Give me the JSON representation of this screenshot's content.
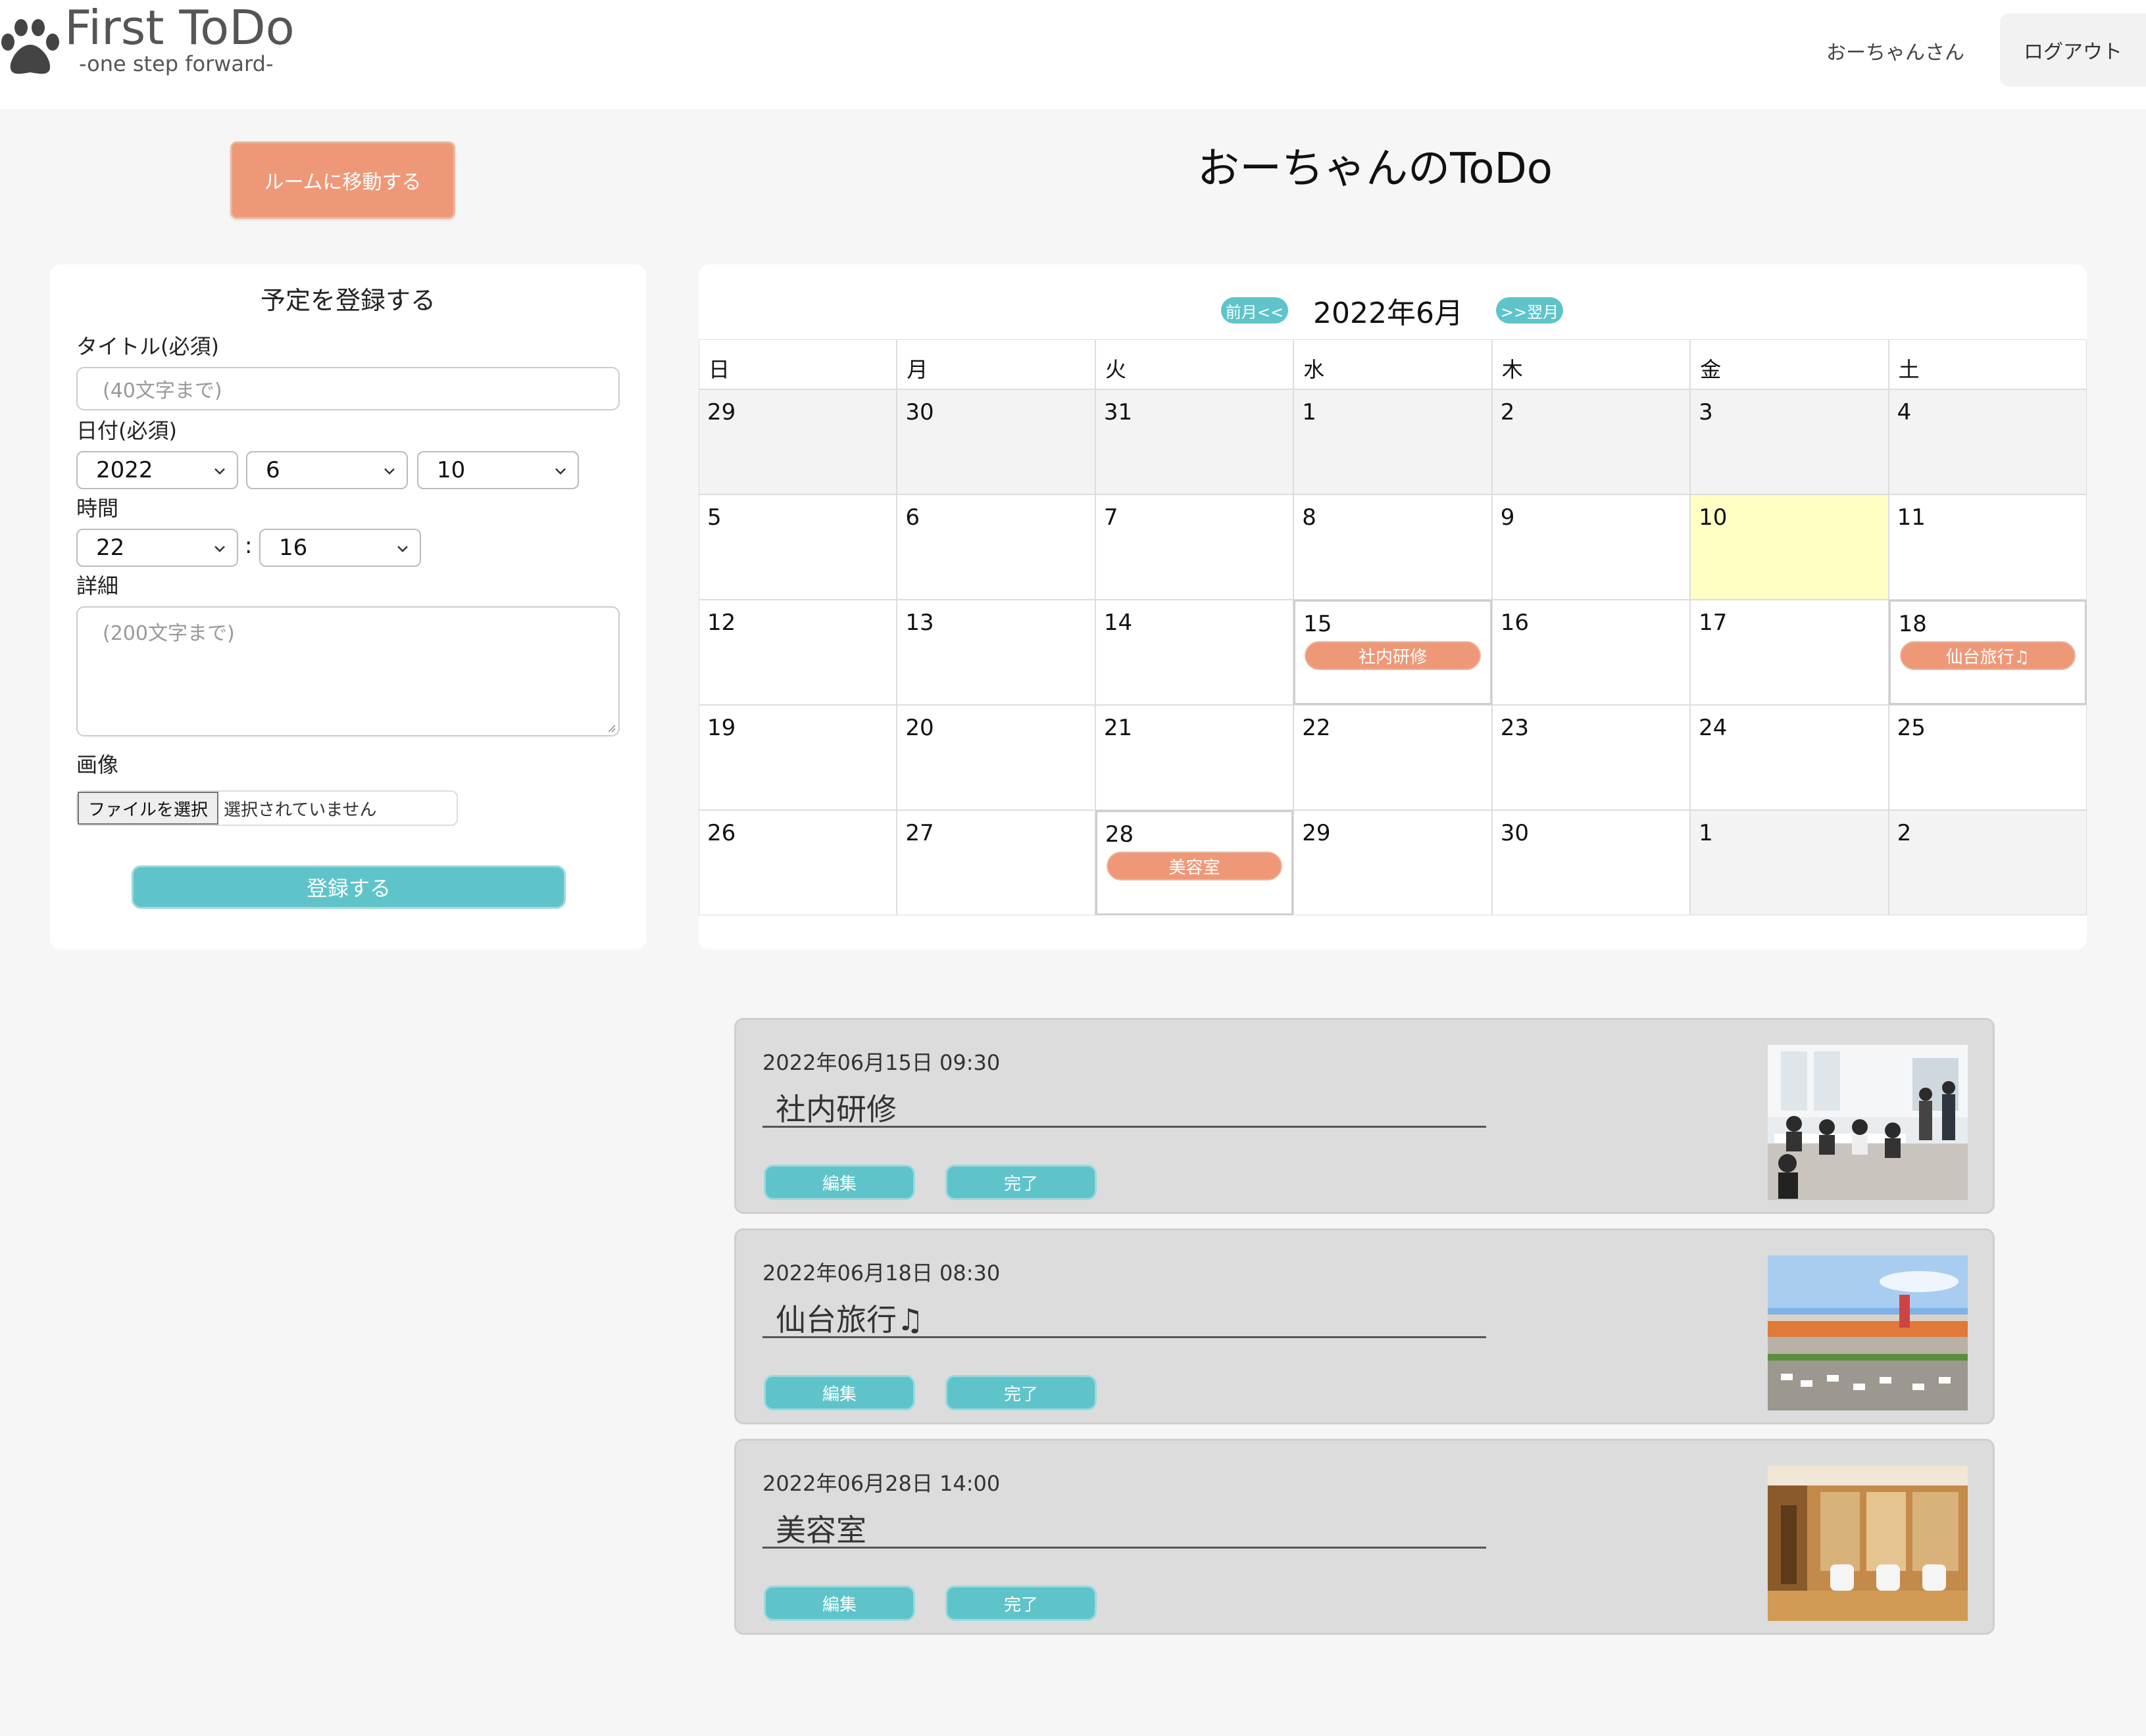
{
  "header": {
    "brand_title": "First ToDo",
    "brand_subtitle": "-one step forward-",
    "user_name": "おーちゃんさん",
    "logout_label": "ログアウト"
  },
  "room_button_label": "ルームに移動する",
  "page_title": "おーちゃんのToDo",
  "form": {
    "heading": "予定を登録する",
    "title_label": "タイトル(必須)",
    "title_placeholder": "(40文字まで)",
    "date_label": "日付(必須)",
    "year": "2022",
    "month": "6",
    "day": "10",
    "time_label": "時間",
    "hour": "22",
    "time_separator": ":",
    "minute": "16",
    "detail_label": "詳細",
    "detail_placeholder": "(200文字まで)",
    "image_label": "画像",
    "file_button": "ファイルを選択",
    "file_status": "選択されていません",
    "submit_label": "登録する"
  },
  "calendar": {
    "prev_label": "前月<<",
    "month_label": "2022年6月",
    "next_label": ">>翌月",
    "weekdays": [
      "日",
      "月",
      "火",
      "水",
      "木",
      "金",
      "土"
    ],
    "weeks": [
      [
        {
          "d": "29",
          "other": true
        },
        {
          "d": "30",
          "other": true
        },
        {
          "d": "31",
          "other": true
        },
        {
          "d": "1",
          "other": true
        },
        {
          "d": "2",
          "other": true
        },
        {
          "d": "3",
          "other": true
        },
        {
          "d": "4",
          "other": true
        }
      ],
      [
        {
          "d": "5"
        },
        {
          "d": "6"
        },
        {
          "d": "7"
        },
        {
          "d": "8"
        },
        {
          "d": "9"
        },
        {
          "d": "10",
          "today": true
        },
        {
          "d": "11"
        }
      ],
      [
        {
          "d": "12"
        },
        {
          "d": "13"
        },
        {
          "d": "14"
        },
        {
          "d": "15",
          "event": "社内研修"
        },
        {
          "d": "16"
        },
        {
          "d": "17"
        },
        {
          "d": "18",
          "event": "仙台旅行♫"
        }
      ],
      [
        {
          "d": "19"
        },
        {
          "d": "20"
        },
        {
          "d": "21"
        },
        {
          "d": "22"
        },
        {
          "d": "23"
        },
        {
          "d": "24"
        },
        {
          "d": "25"
        }
      ],
      [
        {
          "d": "26"
        },
        {
          "d": "27"
        },
        {
          "d": "28",
          "event": "美容室"
        },
        {
          "d": "29"
        },
        {
          "d": "30"
        },
        {
          "d": "1",
          "other": true
        },
        {
          "d": "2",
          "other": true
        }
      ]
    ]
  },
  "todos": [
    {
      "datetime": "2022年06月15日 09:30",
      "title": "社内研修",
      "edit_label": "編集",
      "done_label": "完了",
      "photo": "office-training-photo"
    },
    {
      "datetime": "2022年06月18日 08:30",
      "title": "仙台旅行♫",
      "edit_label": "編集",
      "done_label": "完了",
      "photo": "sendai-station-photo"
    },
    {
      "datetime": "2022年06月28日 14:00",
      "title": "美容室",
      "edit_label": "編集",
      "done_label": "完了",
      "photo": "hair-salon-photo"
    }
  ],
  "colors": {
    "accent_orange": "#ef9878",
    "accent_teal": "#5fc4c9",
    "today_highlight": "#ffffc4",
    "card_bg": "#dcdcdc"
  }
}
